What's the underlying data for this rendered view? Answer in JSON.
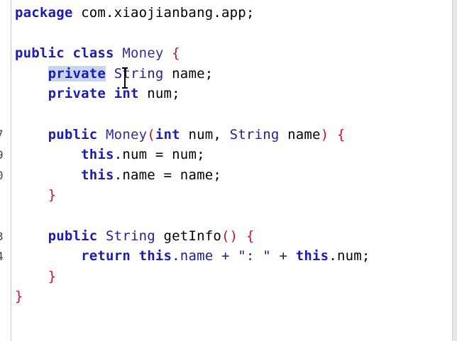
{
  "gutter": {
    "line_numbers": [
      "7",
      "9",
      "0",
      "3",
      "4"
    ]
  },
  "code": {
    "package_kw": "package",
    "package_name": " com.xiaojianbang.app;",
    "class_public": "public",
    "class_kw": "class",
    "class_name": "Money",
    "open_brace": "{",
    "field1_private": "private",
    "field1_type": "String",
    "field1_name": " name;",
    "field2_private": "private",
    "field2_type": "int",
    "field2_name": " num;",
    "ctor_public": "public",
    "ctor_name": "Money",
    "ctor_params_open": "(",
    "ctor_param1_type": "int",
    "ctor_param1_name": " num, ",
    "ctor_param2_type": "String",
    "ctor_param2_name": " name",
    "ctor_params_close": ")",
    "ctor_open": "{",
    "assign1_this": "this",
    "assign1_rest": ".num = num;",
    "assign2_this": "this",
    "assign2_rest": ".name = name;",
    "ctor_close": "}",
    "method_public": "public",
    "method_type": "String",
    "method_name": " getInfo",
    "method_parens": "()",
    "method_open": "{",
    "return_kw": "return",
    "return_this1": "this",
    "return_mid": ".name + \": \" + ",
    "return_this2": "this",
    "return_end": ".num;",
    "method_close": "}",
    "class_close": "}"
  }
}
